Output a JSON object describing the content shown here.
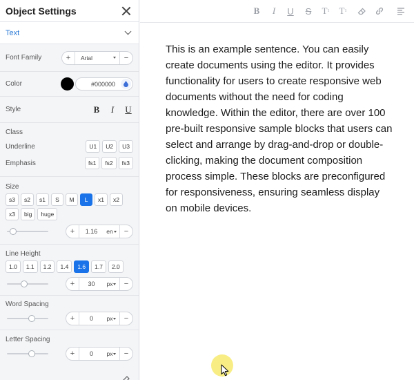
{
  "panel": {
    "title": "Object Settings",
    "type_label": "Text",
    "font_family": {
      "label": "Font Family",
      "value": "Arial",
      "plus": "+",
      "minus": "−"
    },
    "color": {
      "label": "Color",
      "hex": "#000000",
      "swatch": "#000000"
    },
    "style": {
      "label": "Style",
      "bold": "B",
      "italic": "I",
      "underline": "U"
    },
    "class": {
      "label": "Class",
      "underline_label": "Underline",
      "underline_options": [
        "U1",
        "U2",
        "U3"
      ],
      "emphasis_label": "Emphasis",
      "emphasis_options": [
        "fs1",
        "fs2",
        "fs3"
      ]
    },
    "size": {
      "label": "Size",
      "options": [
        "s3",
        "s2",
        "s1",
        "S",
        "M",
        "L",
        "x1",
        "x2",
        "x3",
        "big",
        "huge"
      ],
      "selected": "L",
      "value": "1.16",
      "unit": "en",
      "plus": "+",
      "minus": "−"
    },
    "line_height": {
      "label": "Line Height",
      "options": [
        "1.0",
        "1.1",
        "1.2",
        "1.4",
        "1.6",
        "1.7",
        "2.0"
      ],
      "selected": "1.6",
      "value": "30",
      "unit": "px",
      "plus": "+",
      "minus": "−"
    },
    "word_spacing": {
      "label": "Word Spacing",
      "value": "0",
      "unit": "px",
      "plus": "+",
      "minus": "−"
    },
    "letter_spacing": {
      "label": "Letter Spacing",
      "value": "0",
      "unit": "px",
      "plus": "+",
      "minus": "−"
    }
  },
  "toolbar": {
    "icons": [
      "bold-icon",
      "italic-icon",
      "underline-icon",
      "strikethrough-icon",
      "superscript-icon",
      "subscript-icon",
      "eraser-icon",
      "link-icon",
      "align-icon"
    ],
    "bold": "B",
    "italic": "I",
    "underline": "U",
    "strike": "S",
    "sup": "T",
    "sub": "T"
  },
  "editor": {
    "text": "This is an example sentence. You can easily create documents using the editor. It provides functionality for users to create responsive web documents without the need for coding knowledge. Within the editor, there are over 100 pre-built responsive sample blocks that users can select and arrange by drag-and-drop or double-clicking, making the document composition process simple. These blocks are preconfigured for responsiveness, ensuring seamless display on mobile devices."
  },
  "colors": {
    "accent": "#1a73e8",
    "type_label": "#2a7ad6",
    "cursor_highlight": "#f6e75c"
  }
}
